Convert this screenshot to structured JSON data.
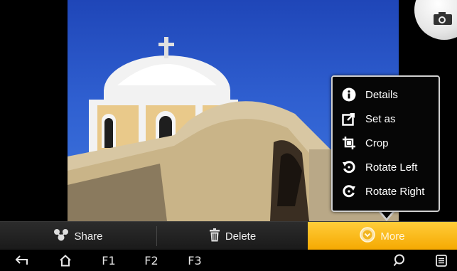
{
  "menu": {
    "items": [
      {
        "label": "Details",
        "icon": "info-icon"
      },
      {
        "label": "Set as",
        "icon": "set-as-icon"
      },
      {
        "label": "Crop",
        "icon": "crop-icon"
      },
      {
        "label": "Rotate Left",
        "icon": "rotate-left-icon"
      },
      {
        "label": "Rotate Right",
        "icon": "rotate-right-icon"
      }
    ]
  },
  "action_bar": {
    "share_label": "Share",
    "delete_label": "Delete",
    "more_label": "More",
    "more_color": "#f5a800"
  },
  "nav_bar": {
    "f1_label": "F1",
    "f2_label": "F2",
    "f3_label": "F3"
  }
}
